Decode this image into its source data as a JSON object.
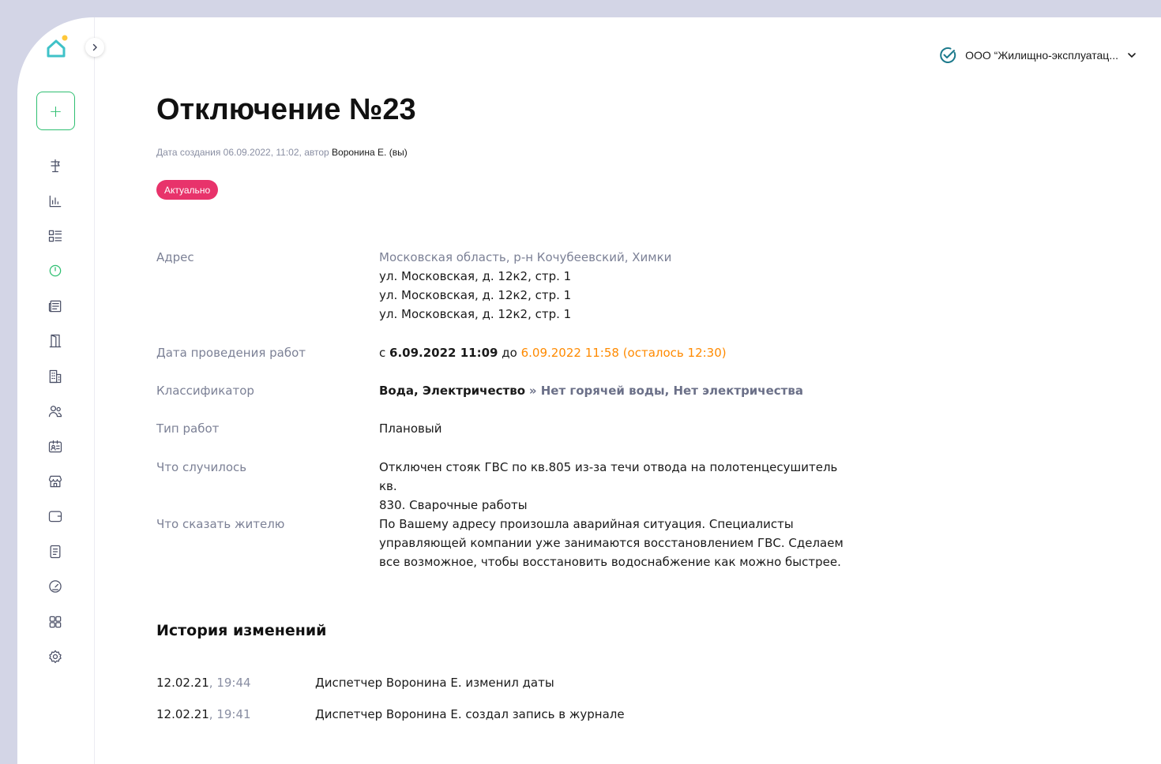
{
  "organization": {
    "name": "ООО “Жилищно-эксплуатац...",
    "verified_icon": "check-circle-icon",
    "dropdown_icon": "chevron-down-icon"
  },
  "sidebar": {
    "logo": "home-logo",
    "add_label": "+",
    "items": [
      {
        "icon": "signpost-icon"
      },
      {
        "icon": "bar-chart-icon"
      },
      {
        "icon": "list-grid-icon"
      },
      {
        "icon": "power-icon",
        "active": true
      },
      {
        "icon": "newspaper-icon"
      },
      {
        "icon": "door-icon"
      },
      {
        "icon": "building-icon"
      },
      {
        "icon": "users-icon"
      },
      {
        "icon": "id-card-icon"
      },
      {
        "icon": "store-icon"
      },
      {
        "icon": "wallet-icon"
      },
      {
        "icon": "document-icon"
      },
      {
        "icon": "gauge-icon"
      },
      {
        "icon": "apps-grid-icon"
      },
      {
        "icon": "settings-icon"
      }
    ]
  },
  "page": {
    "title": "Отключение №23",
    "meta_prefix": "Дата создания 06.09.2022, 11:02, автор",
    "meta_author": "Воронина Е. (вы)",
    "status_badge": "Актуально"
  },
  "details": {
    "address": {
      "label": "Адрес",
      "region": "Московская область, р-н Кочубеевский, Химки",
      "lines": [
        "ул. Московская, д. 12к2, стр. 1",
        "ул. Московская, д. 12к2, стр. 1",
        "ул. Московская, д. 12к2, стр. 1"
      ]
    },
    "work_dates": {
      "label": "Дата проведения работ",
      "from_word": "с",
      "from": "6.09.2022 11:09",
      "to_word": "до",
      "to": "6.09.2022 11:58 (осталось 12:30)"
    },
    "classifier": {
      "label": "Классификатор",
      "main": "Вода, Электричество",
      "sub": "» Нет горячей воды, Нет электричества"
    },
    "work_type": {
      "label": "Тип работ",
      "value": "Плановый"
    },
    "what_happened": {
      "label": "Что случилось",
      "line1": "Отключен стояк ГВС по кв.805 из-за течи отвода на полотенцесушитель кв.",
      "line2": "830. Сварочные работы"
    },
    "resident_message": {
      "label": "Что сказать жителю",
      "line1": "По Вашему адресу произошла аварийная ситуация. Специалисты",
      "line2": "управляющей компании уже занимаются восстановлением ГВС. Сделаем",
      "line3": "все возможное, чтобы восстановить водоснабжение как можно быстрее."
    }
  },
  "history": {
    "title": "История изменений",
    "entries": [
      {
        "date": "12.02.21",
        "time": ", 19:44",
        "text": "Диспетчер Воронина Е. изменил даты"
      },
      {
        "date": "12.02.21",
        "time": ", 19:41",
        "text": "Диспетчер Воронина Е. создал запись в журнале"
      }
    ]
  },
  "colors": {
    "accent_green": "#2fbf71",
    "badge_red": "#e8336b",
    "deadline_orange": "#ff8a00",
    "frame_bg": "#d3d5e6"
  }
}
